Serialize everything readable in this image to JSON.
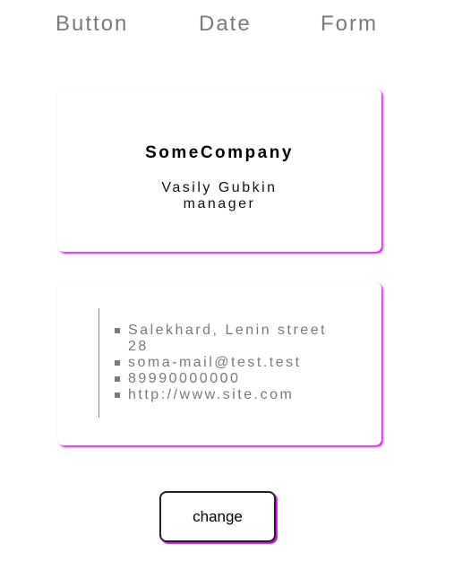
{
  "nav": {
    "items": [
      {
        "label": "Button"
      },
      {
        "label": "Date"
      },
      {
        "label": "Form"
      }
    ]
  },
  "card_front": {
    "company": "SomeCompany",
    "name": "Vasily Gubkin",
    "position": "manager"
  },
  "card_back": {
    "contacts": [
      "Salekhard, Lenin street 28",
      "soma-mail@test.test",
      "89990000000",
      "http://www.site.com"
    ]
  },
  "actions": {
    "change_label": "change"
  },
  "colors": {
    "accent_shadow": "#c400dc",
    "nav_text": "#7a7a7a",
    "contact_text": "#7a7a7a"
  }
}
